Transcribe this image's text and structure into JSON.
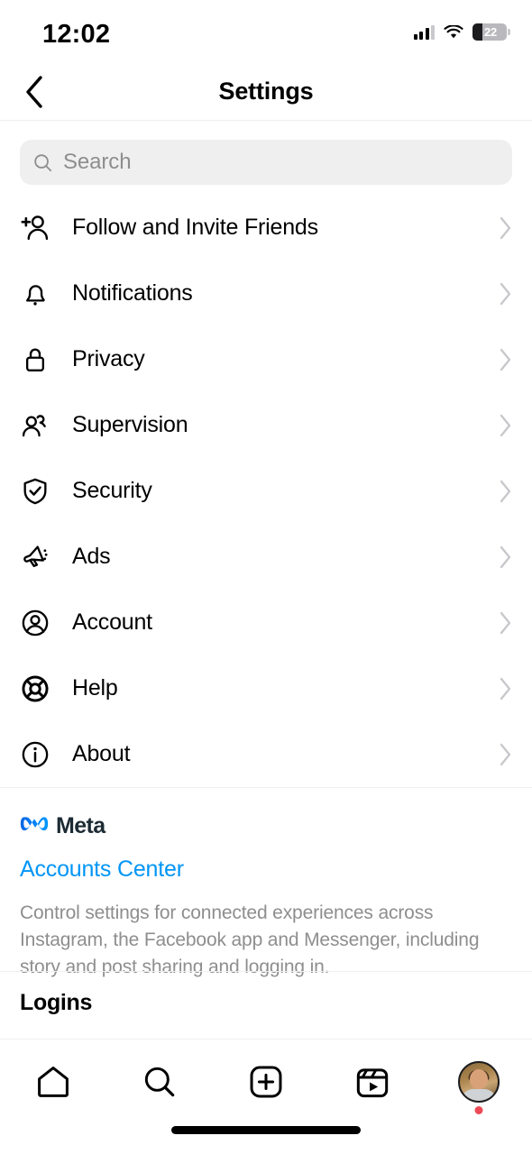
{
  "status_bar": {
    "time": "12:02",
    "battery_level": "22",
    "signal_icon": "cellular-signal-icon",
    "wifi_icon": "wifi-icon",
    "battery_icon": "battery-icon"
  },
  "header": {
    "title": "Settings",
    "back_icon": "back-chevron-icon"
  },
  "search": {
    "placeholder": "Search",
    "icon": "search-icon"
  },
  "settings_items": [
    {
      "label": "Follow and Invite Friends",
      "icon": "person-add-icon"
    },
    {
      "label": "Notifications",
      "icon": "bell-icon"
    },
    {
      "label": "Privacy",
      "icon": "lock-icon"
    },
    {
      "label": "Supervision",
      "icon": "people-icon"
    },
    {
      "label": "Security",
      "icon": "shield-check-icon"
    },
    {
      "label": "Ads",
      "icon": "megaphone-icon"
    },
    {
      "label": "Account",
      "icon": "account-circle-icon"
    },
    {
      "label": "Help",
      "icon": "lifebuoy-icon"
    },
    {
      "label": "About",
      "icon": "info-circle-icon"
    }
  ],
  "meta_section": {
    "brand": "Meta",
    "brand_icon": "meta-infinity-logo",
    "link": "Accounts Center",
    "description": "Control settings for connected experiences across Instagram, the Facebook app and Messenger, including story and post sharing and logging in."
  },
  "logins_section": {
    "title": "Logins"
  },
  "tab_bar": [
    {
      "name": "home",
      "icon": "home-icon"
    },
    {
      "name": "search",
      "icon": "search-icon"
    },
    {
      "name": "create",
      "icon": "plus-square-icon"
    },
    {
      "name": "reels",
      "icon": "reels-icon"
    },
    {
      "name": "profile",
      "icon": "profile-avatar"
    }
  ],
  "colors": {
    "accent_blue": "#0095f6",
    "meta_blue": "#0081fb",
    "notification_red": "#ed4956",
    "divider": "#efefef",
    "search_bg": "#efefef",
    "secondary_text": "#8e8e8e",
    "chevron": "#c7c7cc"
  }
}
